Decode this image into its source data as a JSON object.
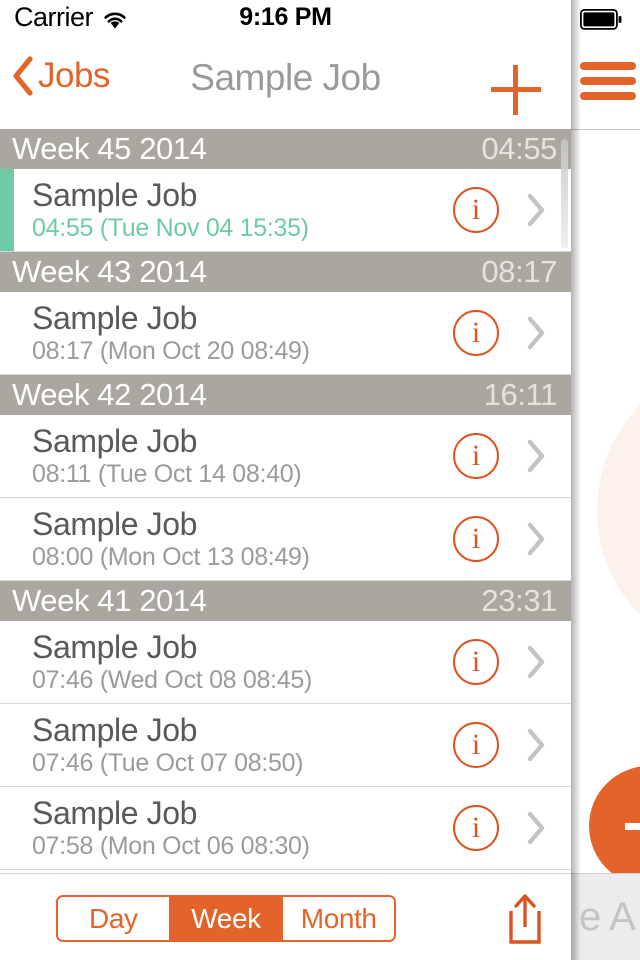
{
  "colors": {
    "accent_orange": "#E2642A",
    "info_orange": "#D9541E",
    "section_gray": "#AAA6A0",
    "active_green": "#6FCBA3",
    "title_gray": "#9A9A9A",
    "row_title": "#59595B",
    "row_sub": "#9B9B9B",
    "fab_circle_bg": "#FCF1ED"
  },
  "status_bar": {
    "carrier": "Carrier",
    "wifi_icon": "wifi-icon",
    "time": "9:16 PM",
    "battery_icon": "battery-full-icon"
  },
  "nav_bar": {
    "back_icon": "chevron-left-icon",
    "back_label": "Jobs",
    "title": "Sample Job",
    "add_icon": "plus-icon"
  },
  "list": {
    "sections": [
      {
        "title": "Week 45 2014",
        "total": "04:55",
        "entries": [
          {
            "title": "Sample Job",
            "subtitle": "04:55 (Tue Nov 04 15:35)",
            "active": true,
            "info_icon": "info-circle-icon",
            "disclosure_icon": "chevron-right-icon"
          }
        ]
      },
      {
        "title": "Week 43 2014",
        "total": "08:17",
        "entries": [
          {
            "title": "Sample Job",
            "subtitle": "08:17 (Mon Oct 20 08:49)",
            "active": false,
            "info_icon": "info-circle-icon",
            "disclosure_icon": "chevron-right-icon"
          }
        ]
      },
      {
        "title": "Week 42 2014",
        "total": "16:11",
        "entries": [
          {
            "title": "Sample Job",
            "subtitle": "08:11 (Tue Oct 14 08:40)",
            "active": false,
            "info_icon": "info-circle-icon",
            "disclosure_icon": "chevron-right-icon"
          },
          {
            "title": "Sample Job",
            "subtitle": "08:00 (Mon Oct 13 08:49)",
            "active": false,
            "info_icon": "info-circle-icon",
            "disclosure_icon": "chevron-right-icon"
          }
        ]
      },
      {
        "title": "Week 41 2014",
        "total": "23:31",
        "entries": [
          {
            "title": "Sample Job",
            "subtitle": "07:46 (Wed Oct 08 08:45)",
            "active": false,
            "info_icon": "info-circle-icon",
            "disclosure_icon": "chevron-right-icon"
          },
          {
            "title": "Sample Job",
            "subtitle": "07:46 (Tue Oct 07 08:50)",
            "active": false,
            "info_icon": "info-circle-icon",
            "disclosure_icon": "chevron-right-icon"
          },
          {
            "title": "Sample Job",
            "subtitle": "07:58 (Mon Oct 06 08:30)",
            "active": false,
            "info_icon": "info-circle-icon",
            "disclosure_icon": "chevron-right-icon"
          }
        ]
      }
    ]
  },
  "toolbar": {
    "segments": [
      {
        "label": "Day",
        "selected": false
      },
      {
        "label": "Week",
        "selected": true
      },
      {
        "label": "Month",
        "selected": false
      }
    ],
    "share_icon": "share-upload-icon"
  },
  "right_panel": {
    "menu_icon": "hamburger-menu-icon",
    "fab_icon": "plus-icon",
    "footer_text": "e A"
  }
}
